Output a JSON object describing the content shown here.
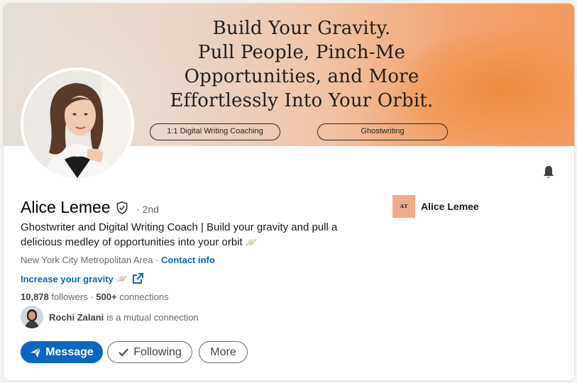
{
  "banner": {
    "headline_lines": [
      "Build Your Gravity.",
      "Pull People, Pinch-Me",
      "Opportunities, and More",
      "Effortlessly Into Your Orbit."
    ],
    "pill_left": "1:1 Digital Writing Coaching",
    "pill_right": "Ghostwriting"
  },
  "profile": {
    "name": "Alice Lemee",
    "degree": "· 2nd",
    "tagline": "Ghostwriter and Digital Writing Coach | Build your gravity and pull a delicious medley of opportunities into your orbit",
    "tagline_emoji": "🪐",
    "location": "New York City Metropolitan Area",
    "location_sep": " · ",
    "contact_info": "Contact info",
    "website": "Increase your gravity",
    "website_emoji": "🪐",
    "followers_count": "10,878",
    "followers_label": "followers",
    "connections_count": "500+",
    "connections_label": "connections",
    "mutual_name": "Rochi Zalani",
    "mutual_text": "is a mutual connection"
  },
  "company": {
    "logo_text": "ᴀᴛ",
    "name": "Alice Lemee"
  },
  "actions": {
    "message": "Message",
    "following": "Following",
    "more": "More"
  },
  "colors": {
    "primary": "#0a66c2",
    "banner_orange": "#f39a5e",
    "company_logo_bg": "#f0ab8a"
  }
}
